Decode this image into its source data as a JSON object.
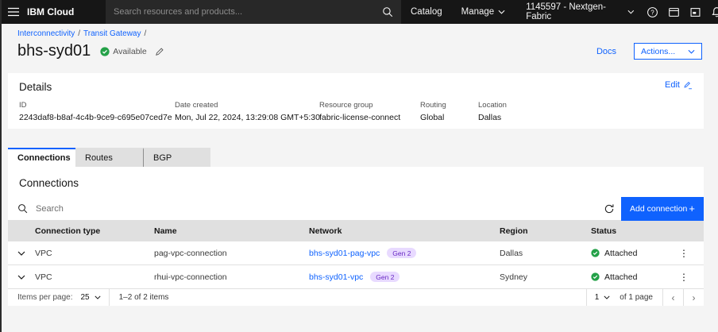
{
  "header": {
    "brand": "IBM Cloud",
    "search_placeholder": "Search resources and products...",
    "catalog": "Catalog",
    "manage": "Manage",
    "account": "1145597 - Nextgen-Fabric"
  },
  "page": {
    "breadcrumb": [
      "Interconnectivity",
      "Transit Gateway"
    ],
    "breadcrumb_separator": "/",
    "title": "bhs-syd01",
    "status": "Available",
    "docs": "Docs",
    "actions": "Actions..."
  },
  "details": {
    "heading": "Details",
    "edit": "Edit",
    "fields": [
      {
        "label": "ID",
        "value": "2243daf8-b8af-4c4b-9ce9-c695e07ced7e"
      },
      {
        "label": "Date created",
        "value": "Mon, Jul 22, 2024, 13:29:08 GMT+5:30"
      },
      {
        "label": "Resource group",
        "value": "fabric-license-connect"
      },
      {
        "label": "Routing",
        "value": "Global"
      },
      {
        "label": "Location",
        "value": "Dallas"
      }
    ]
  },
  "tabs": [
    {
      "label": "Connections"
    },
    {
      "label": "Routes"
    },
    {
      "label": "BGP"
    }
  ],
  "connections": {
    "heading": "Connections",
    "search_placeholder": "Search",
    "add_button": "Add connection",
    "table": {
      "headers": [
        "Connection type",
        "Name",
        "Network",
        "Region",
        "Status"
      ],
      "rows": [
        {
          "type": "VPC",
          "name": "pag-vpc-connection",
          "network": "bhs-syd01-pag-vpc",
          "badge": "Gen 2",
          "region": "Dallas",
          "status": "Attached"
        },
        {
          "type": "VPC",
          "name": "rhui-vpc-connection",
          "network": "bhs-syd01-vpc",
          "badge": "Gen 2",
          "region": "Sydney",
          "status": "Attached"
        }
      ]
    },
    "pagination": {
      "items_per_page_label": "Items per page:",
      "items_per_page_value": "25",
      "range_text": "1–2 of 2 items",
      "page_value": "1",
      "page_suffix": "of 1 page"
    }
  },
  "icons": {
    "plus": "+",
    "overflow": "⋮",
    "prev": "‹",
    "next": "›"
  },
  "colors": {
    "accent": "#0f62fe",
    "success": "#24a148",
    "badge_bg": "#e8daff",
    "badge_text": "#6929c4",
    "header_bg": "#161616",
    "page_bg": "#f4f4f4"
  }
}
